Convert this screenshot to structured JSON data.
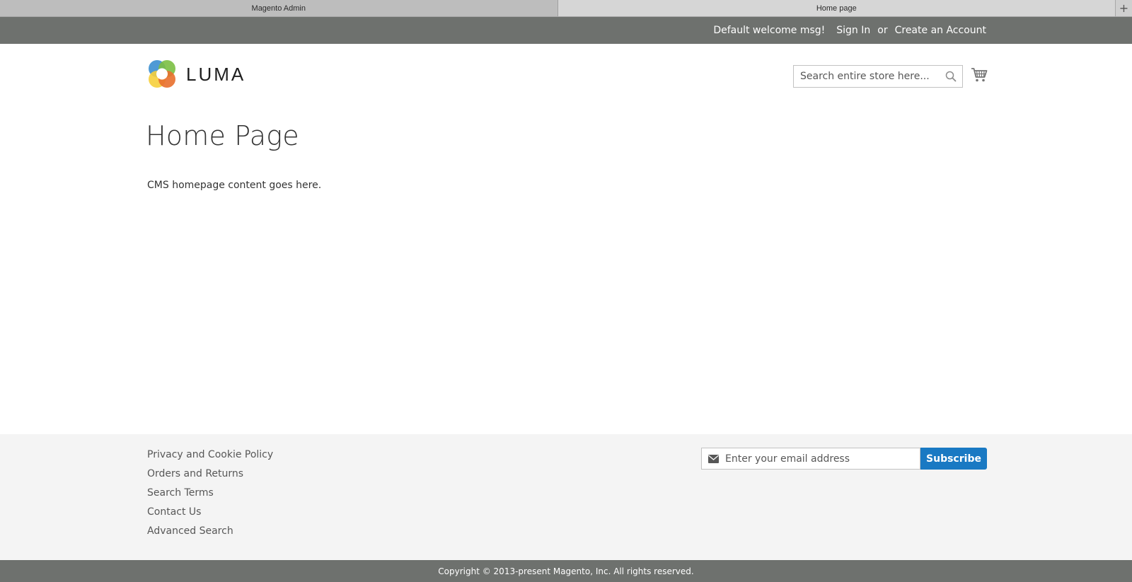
{
  "browser": {
    "tabs": [
      {
        "label": "Magento Admin",
        "active": false
      },
      {
        "label": "Home page",
        "active": true
      }
    ],
    "new_tab": "+"
  },
  "panel": {
    "welcome": "Default welcome msg!",
    "sign_in": "Sign In",
    "or": "or",
    "create_account": "Create an Account"
  },
  "header": {
    "logo_text": "LUMA",
    "search_placeholder": "Search entire store here...",
    "search_icon": "search-icon",
    "cart_icon": "cart-icon"
  },
  "main": {
    "title": "Home Page",
    "content": "CMS homepage content goes here."
  },
  "footer": {
    "links": [
      "Privacy and Cookie Policy",
      "Orders and Returns",
      "Search Terms",
      "Contact Us",
      "Advanced Search"
    ],
    "newsletter": {
      "placeholder": "Enter your email address",
      "button": "Subscribe",
      "icon": "envelope-icon"
    },
    "copyright": "Copyright © 2013-present Magento, Inc. All rights reserved."
  },
  "colors": {
    "panel_bg": "#6e716e",
    "footer_bg": "#f4f4f4",
    "accent": "#1979c3"
  }
}
